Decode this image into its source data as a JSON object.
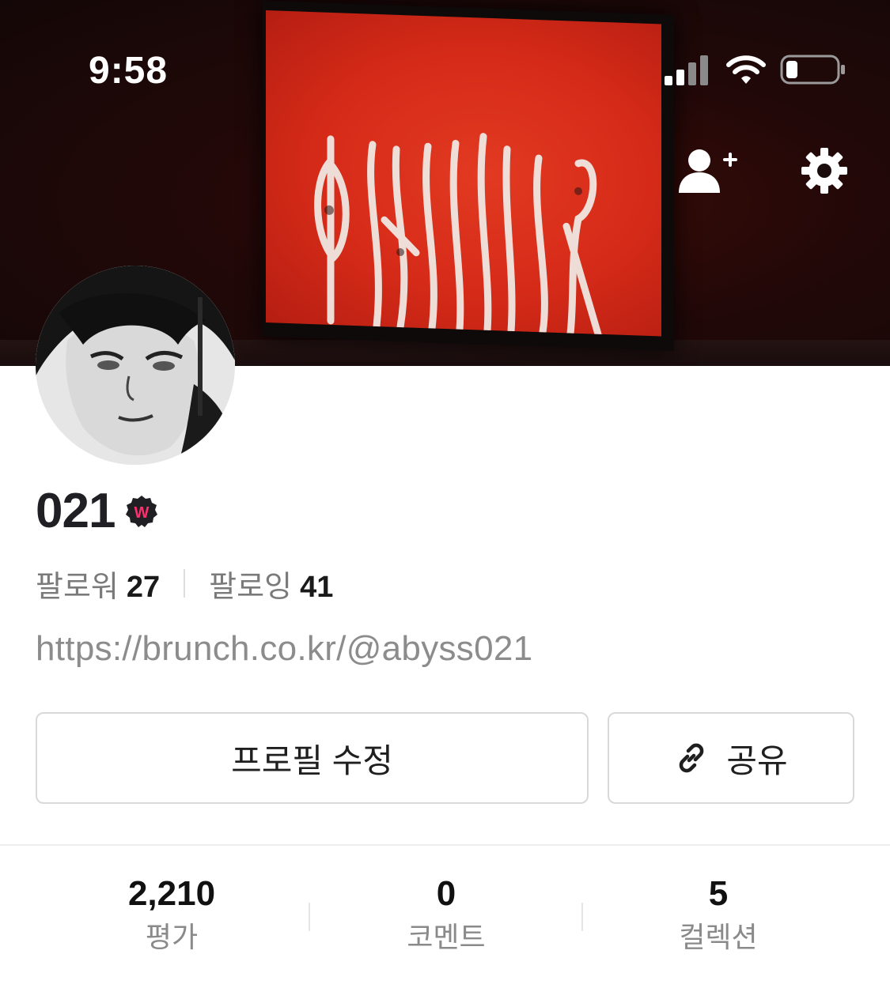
{
  "status_bar": {
    "time": "9:58"
  },
  "profile": {
    "name": "021",
    "badge_letter": "W",
    "followers_label": "팔로워",
    "followers_count": "27",
    "following_label": "팔로잉",
    "following_count": "41",
    "link": "https://brunch.co.kr/@abyss021"
  },
  "actions": {
    "edit_profile": "프로필 수정",
    "share": "공유"
  },
  "stats": [
    {
      "value": "2,210",
      "label": "평가"
    },
    {
      "value": "0",
      "label": "코멘트"
    },
    {
      "value": "5",
      "label": "컬렉션"
    }
  ],
  "icons": {
    "add_friend": "add-friend-icon",
    "settings": "gear-icon",
    "share": "link-icon",
    "badge": "badge-icon"
  },
  "colors": {
    "badge_accent": "#ff2f6e",
    "cover_screen": "#d52a18",
    "text_muted": "#8c8c8c"
  }
}
